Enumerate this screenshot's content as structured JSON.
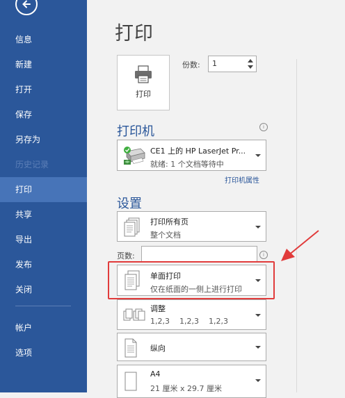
{
  "nav": {
    "items": [
      {
        "label": "信息"
      },
      {
        "label": "新建"
      },
      {
        "label": "打开"
      },
      {
        "label": "保存"
      },
      {
        "label": "另存为"
      },
      {
        "label": "历史记录"
      },
      {
        "label": "打印"
      },
      {
        "label": "共享"
      },
      {
        "label": "导出"
      },
      {
        "label": "发布"
      },
      {
        "label": "关闭"
      },
      {
        "label": "帐户"
      },
      {
        "label": "选项"
      }
    ],
    "active": "打印"
  },
  "main": {
    "title": "打印",
    "print_button_label": "打印",
    "copies_label": "份数:",
    "copies_value": "1",
    "printer_section_title": "打印机",
    "printer": {
      "name": "CE1 上的 HP LaserJet Pr...",
      "status": "就绪: 1 个文档等待中"
    },
    "printer_properties_link": "打印机属性",
    "settings_section_title": "设置",
    "print_range": {
      "line1": "打印所有页",
      "line2": "整个文档"
    },
    "pages_label": "页数:",
    "pages_value": "",
    "sides": {
      "line1": "单面打印",
      "line2": "仅在纸面的一侧上进行打印"
    },
    "collate": {
      "line1": "调整",
      "line2": "1,2,3    1,2,3    1,2,3"
    },
    "orientation": {
      "line1": "纵向"
    },
    "paper_size": {
      "line1": "A4",
      "line2": "21 厘米 x 29.7 厘米"
    },
    "info_icon_glyph": "i"
  },
  "colors": {
    "sidebar": "#2b579a",
    "sidebar_active": "#4774b8",
    "accent": "#2b579a",
    "highlight": "#e13b3b"
  }
}
